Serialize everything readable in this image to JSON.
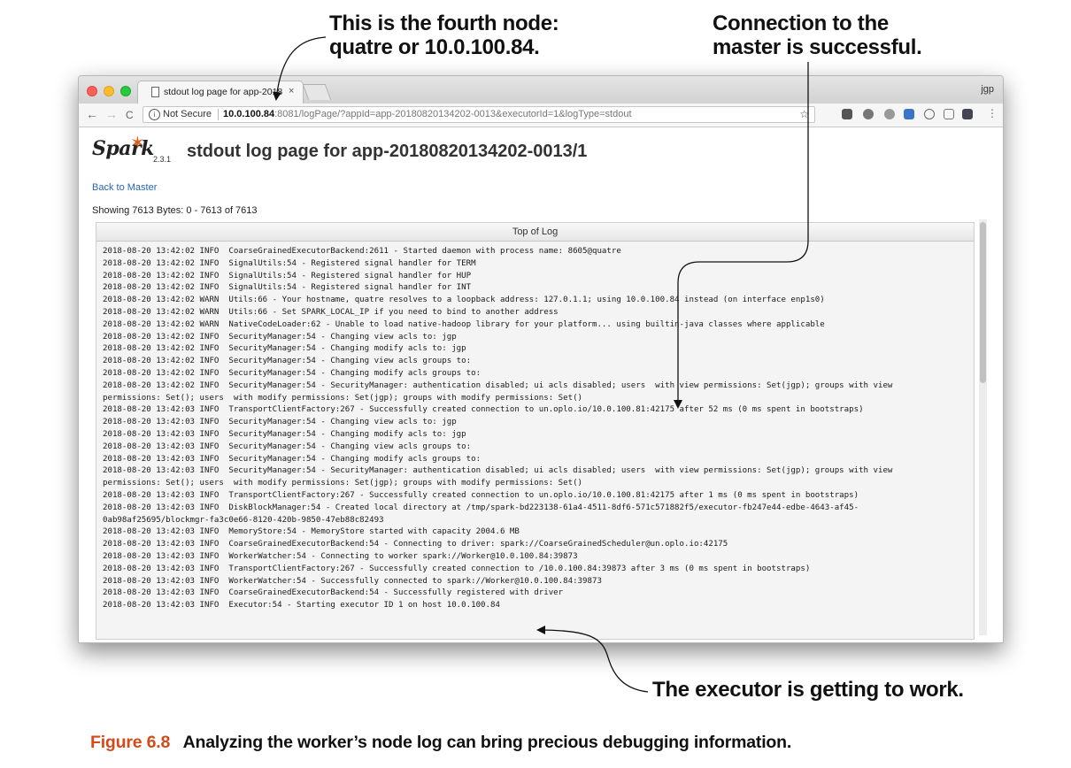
{
  "annotations": {
    "fourth_node": [
      "This is the fourth node:",
      "quatre or 10.0.100.84."
    ],
    "connection": [
      "Connection to the",
      "master is successful."
    ],
    "executor": "The executor is getting to work."
  },
  "caption": {
    "label": "Figure 6.8",
    "text": "Analyzing the worker’s node log can bring precious debugging information."
  },
  "browser": {
    "tab_title": "stdout log page for app-2018",
    "tab_close": "×",
    "profile": "jgp",
    "nav": {
      "back": "←",
      "forward": "→",
      "reload": "C"
    },
    "security_label": "Not Secure",
    "url_host": "10.0.100.84",
    "url_rest": ":8081/logPage/?appId=app-20180820134202-0013&executorId=1&logType=stdout",
    "star": "☆"
  },
  "page": {
    "logo_text": "Spark",
    "version": "2.3.1",
    "title": "stdout log page for app-20180820134202-0013/1",
    "back_link": "Back to Master",
    "showing": "Showing 7613 Bytes: 0 - 7613 of 7613",
    "top_of_log": "Top of Log"
  },
  "log_lines": [
    "2018-08-20 13:42:02 INFO  CoarseGrainedExecutorBackend:2611 - Started daemon with process name: 8605@quatre",
    "2018-08-20 13:42:02 INFO  SignalUtils:54 - Registered signal handler for TERM",
    "2018-08-20 13:42:02 INFO  SignalUtils:54 - Registered signal handler for HUP",
    "2018-08-20 13:42:02 INFO  SignalUtils:54 - Registered signal handler for INT",
    "2018-08-20 13:42:02 WARN  Utils:66 - Your hostname, quatre resolves to a loopback address: 127.0.1.1; using 10.0.100.84 instead (on interface enp1s0)",
    "2018-08-20 13:42:02 WARN  Utils:66 - Set SPARK_LOCAL_IP if you need to bind to another address",
    "2018-08-20 13:42:02 WARN  NativeCodeLoader:62 - Unable to load native-hadoop library for your platform... using builtin-java classes where applicable",
    "2018-08-20 13:42:02 INFO  SecurityManager:54 - Changing view acls to: jgp",
    "2018-08-20 13:42:02 INFO  SecurityManager:54 - Changing modify acls to: jgp",
    "2018-08-20 13:42:02 INFO  SecurityManager:54 - Changing view acls groups to:",
    "2018-08-20 13:42:02 INFO  SecurityManager:54 - Changing modify acls groups to:",
    "2018-08-20 13:42:02 INFO  SecurityManager:54 - SecurityManager: authentication disabled; ui acls disabled; users  with view permissions: Set(jgp); groups with view",
    "permissions: Set(); users  with modify permissions: Set(jgp); groups with modify permissions: Set()",
    "2018-08-20 13:42:03 INFO  TransportClientFactory:267 - Successfully created connection to un.oplo.io/10.0.100.81:42175 after 52 ms (0 ms spent in bootstraps)",
    "2018-08-20 13:42:03 INFO  SecurityManager:54 - Changing view acls to: jgp",
    "2018-08-20 13:42:03 INFO  SecurityManager:54 - Changing modify acls to: jgp",
    "2018-08-20 13:42:03 INFO  SecurityManager:54 - Changing view acls groups to:",
    "2018-08-20 13:42:03 INFO  SecurityManager:54 - Changing modify acls groups to:",
    "2018-08-20 13:42:03 INFO  SecurityManager:54 - SecurityManager: authentication disabled; ui acls disabled; users  with view permissions: Set(jgp); groups with view",
    "permissions: Set(); users  with modify permissions: Set(jgp); groups with modify permissions: Set()",
    "2018-08-20 13:42:03 INFO  TransportClientFactory:267 - Successfully created connection to un.oplo.io/10.0.100.81:42175 after 1 ms (0 ms spent in bootstraps)",
    "2018-08-20 13:42:03 INFO  DiskBlockManager:54 - Created local directory at /tmp/spark-bd223138-61a4-4511-8df6-571c571882f5/executor-fb247e44-edbe-4643-af45-",
    "0ab98af25695/blockmgr-fa3c0e66-8120-420b-9850-47eb88c82493",
    "2018-08-20 13:42:03 INFO  MemoryStore:54 - MemoryStore started with capacity 2004.6 MB",
    "2018-08-20 13:42:03 INFO  CoarseGrainedExecutorBackend:54 - Connecting to driver: spark://CoarseGrainedScheduler@un.oplo.io:42175",
    "2018-08-20 13:42:03 INFO  WorkerWatcher:54 - Connecting to worker spark://Worker@10.0.100.84:39873",
    "2018-08-20 13:42:03 INFO  TransportClientFactory:267 - Successfully created connection to /10.0.100.84:39873 after 3 ms (0 ms spent in bootstraps)",
    "2018-08-20 13:42:03 INFO  WorkerWatcher:54 - Successfully connected to spark://Worker@10.0.100.84:39873",
    "2018-08-20 13:42:03 INFO  CoarseGrainedExecutorBackend:54 - Successfully registered with driver",
    "2018-08-20 13:42:03 INFO  Executor:54 - Starting executor ID 1 on host 10.0.100.84"
  ],
  "colors": {
    "spark_orange": "#e25a1c",
    "caption_label": "#d54a1a",
    "link": "#2864b4"
  }
}
